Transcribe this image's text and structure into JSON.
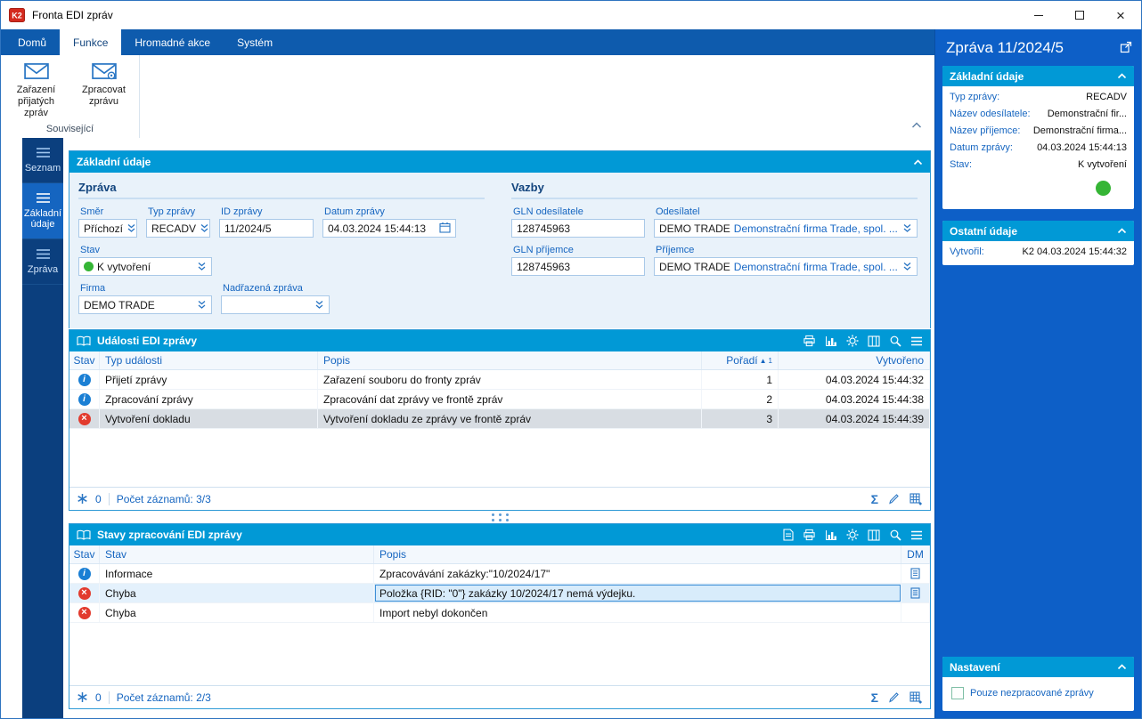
{
  "glyphs": {
    "info": "i",
    "cross": "×",
    "close": "×",
    "sort_asc": "▲",
    "sort_num": "1",
    "sigma": "Σ"
  },
  "colors": {
    "ribbon_blue": "#0e5bad",
    "panel_header_blue": "#0199d6",
    "right_panel_blue": "#0d5fc7",
    "status_green": "#35b535",
    "status_red": "#e23b2e",
    "status_info": "#1a7fd4",
    "accent_blue": "#1565c0"
  },
  "window": {
    "title": "Fronta EDI zpráv"
  },
  "ribbon": {
    "tabs": [
      {
        "label": "Domů"
      },
      {
        "label": "Funkce"
      },
      {
        "label": "Hromadné akce"
      },
      {
        "label": "Systém"
      }
    ],
    "buttons": [
      {
        "label": "Zařazení přijatých zpráv"
      },
      {
        "label": "Zpracovat zprávu"
      }
    ],
    "group_label": "Související"
  },
  "sidebar": {
    "items": [
      {
        "label": "Seznam"
      },
      {
        "label": "Základní údaje"
      },
      {
        "label": "Zpráva"
      }
    ]
  },
  "basic_panel": {
    "title": "Základní údaje",
    "left_section": "Zpráva",
    "right_section": "Vazby",
    "fields": {
      "smer": {
        "label": "Směr",
        "value": "Příchozí"
      },
      "typ": {
        "label": "Typ zprávy",
        "value": "RECADV"
      },
      "id": {
        "label": "ID zprávy",
        "value": "11/2024/5"
      },
      "datum": {
        "label": "Datum zprávy",
        "value": "04.03.2024 15:44:13"
      },
      "stav": {
        "label": "Stav",
        "value": "K vytvoření"
      },
      "firma": {
        "label": "Firma",
        "value": "DEMO TRADE"
      },
      "nadrazena": {
        "label": "Nadřazená zpráva",
        "value": ""
      },
      "gln_odesilatele": {
        "label": "GLN odesílatele",
        "value": "128745963"
      },
      "odesilatel": {
        "label": "Odesílatel",
        "code": "DEMO TRADE",
        "name": "Demonstrační firma Trade, spol. ..."
      },
      "gln_prijemce": {
        "label": "GLN příjemce",
        "value": "128745963"
      },
      "prijemce": {
        "label": "Příjemce",
        "code": "DEMO TRADE",
        "name": "Demonstrační firma Trade, spol. ..."
      }
    }
  },
  "events_panel": {
    "title": "Události EDI zprávy",
    "columns": [
      "Stav",
      "Typ události",
      "Popis",
      "Pořadí",
      "Vytvořeno"
    ],
    "rows": [
      {
        "status": "info",
        "typ": "Přijetí zprávy",
        "popis": "Zařazení souboru do fronty zpráv",
        "poradi": "1",
        "vytvoreno": "04.03.2024 15:44:32"
      },
      {
        "status": "info",
        "typ": "Zpracování zprávy",
        "popis": "Zpracování dat zprávy ve frontě zpráv",
        "poradi": "2",
        "vytvoreno": "04.03.2024 15:44:38"
      },
      {
        "status": "error",
        "typ": "Vytvoření dokladu",
        "popis": "Vytvoření dokladu ze zprávy ve frontě zpráv",
        "poradi": "3",
        "vytvoreno": "04.03.2024 15:44:39"
      }
    ],
    "footer": {
      "counter": "0",
      "records": "Počet záznamů: 3/3"
    }
  },
  "states_panel": {
    "title": "Stavy zpracování EDI zprávy",
    "columns": [
      "Stav",
      "Stav",
      "Popis",
      "DM"
    ],
    "rows": [
      {
        "status": "info",
        "stav": "Informace",
        "popis": "Zpracovávání zakázky:\"10/2024/17\"",
        "dm": true
      },
      {
        "status": "error",
        "stav": "Chyba",
        "popis": "Položka {RID: \"0\"} zakázky 10/2024/17 nemá výdejku.",
        "dm": true
      },
      {
        "status": "error",
        "stav": "Chyba",
        "popis": "Import nebyl dokončen",
        "dm": false
      }
    ],
    "footer": {
      "counter": "0",
      "records": "Počet záznamů: 2/3"
    }
  },
  "right_panel": {
    "title": "Zpráva 11/2024/5",
    "basic": {
      "title": "Základní údaje",
      "rows": [
        {
          "label": "Typ zprávy:",
          "value": "RECADV"
        },
        {
          "label": "Název odesílatele:",
          "value": "Demonstrační fir..."
        },
        {
          "label": "Název příjemce:",
          "value": "Demonstrační firma..."
        },
        {
          "label": "Datum zprávy:",
          "value": "04.03.2024 15:44:13"
        },
        {
          "label": "Stav:",
          "value": "K vytvoření"
        }
      ]
    },
    "other": {
      "title": "Ostatní údaje",
      "rows": [
        {
          "label": "Vytvořil:",
          "value": "K2 04.03.2024 15:44:32"
        }
      ]
    },
    "settings": {
      "title": "Nastavení",
      "checkbox_label": "Pouze nezpracované zprávy"
    }
  }
}
